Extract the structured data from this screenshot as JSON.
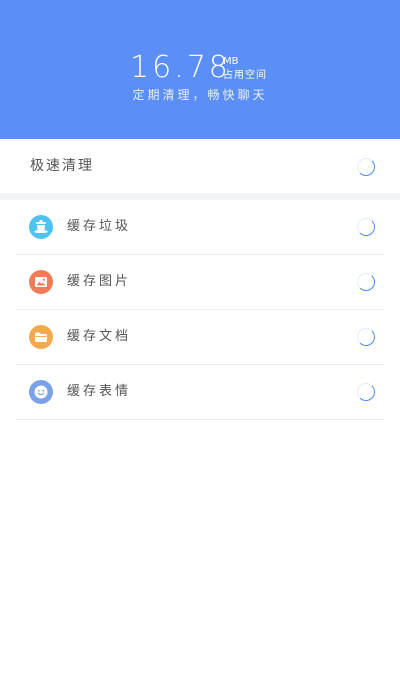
{
  "header": {
    "size_value": "16.78",
    "size_unit": "MB",
    "size_label": "占用空间",
    "slogan": "定期清理，畅快聊天"
  },
  "quick_clean": {
    "label": "极速清理"
  },
  "items": [
    {
      "label": "缓存垃圾",
      "icon": "trash-can-icon",
      "color": "#4fc3f0"
    },
    {
      "label": "缓存图片",
      "icon": "image-icon",
      "color": "#f07c57"
    },
    {
      "label": "缓存文档",
      "icon": "folder-icon",
      "color": "#f5a94f"
    },
    {
      "label": "缓存表情",
      "icon": "smiley-icon",
      "color": "#7aa2e8"
    }
  ],
  "colors": {
    "header_bg": "#5b8ff5",
    "spinner": "#4a8cf0"
  }
}
